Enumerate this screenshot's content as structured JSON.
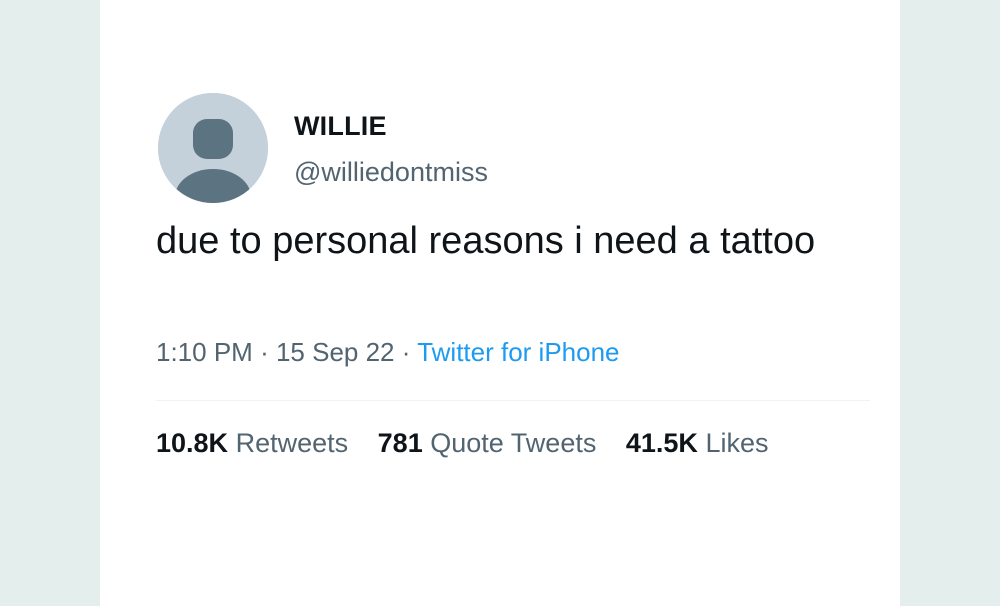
{
  "colors": {
    "background": "#e3eeed",
    "card": "#ffffff",
    "text_primary": "#0f1419",
    "text_secondary": "#536471",
    "link": "#1d9bf0",
    "avatar_bg": "#c4d1da",
    "avatar_figure": "#5c7382"
  },
  "tweet": {
    "avatar_icon": "default-profile-icon",
    "display_name": "WILLIE",
    "handle": "@williedontmiss",
    "text": "due to personal reasons i need a tattoo",
    "time": "1:10 PM",
    "separator": "·",
    "date": "15 Sep 22",
    "source": "Twitter for iPhone"
  },
  "stats": {
    "retweets_count": "10.8K",
    "retweets_label": "Retweets",
    "quotes_count": "781",
    "quotes_label": "Quote Tweets",
    "likes_count": "41.5K",
    "likes_label": "Likes"
  }
}
